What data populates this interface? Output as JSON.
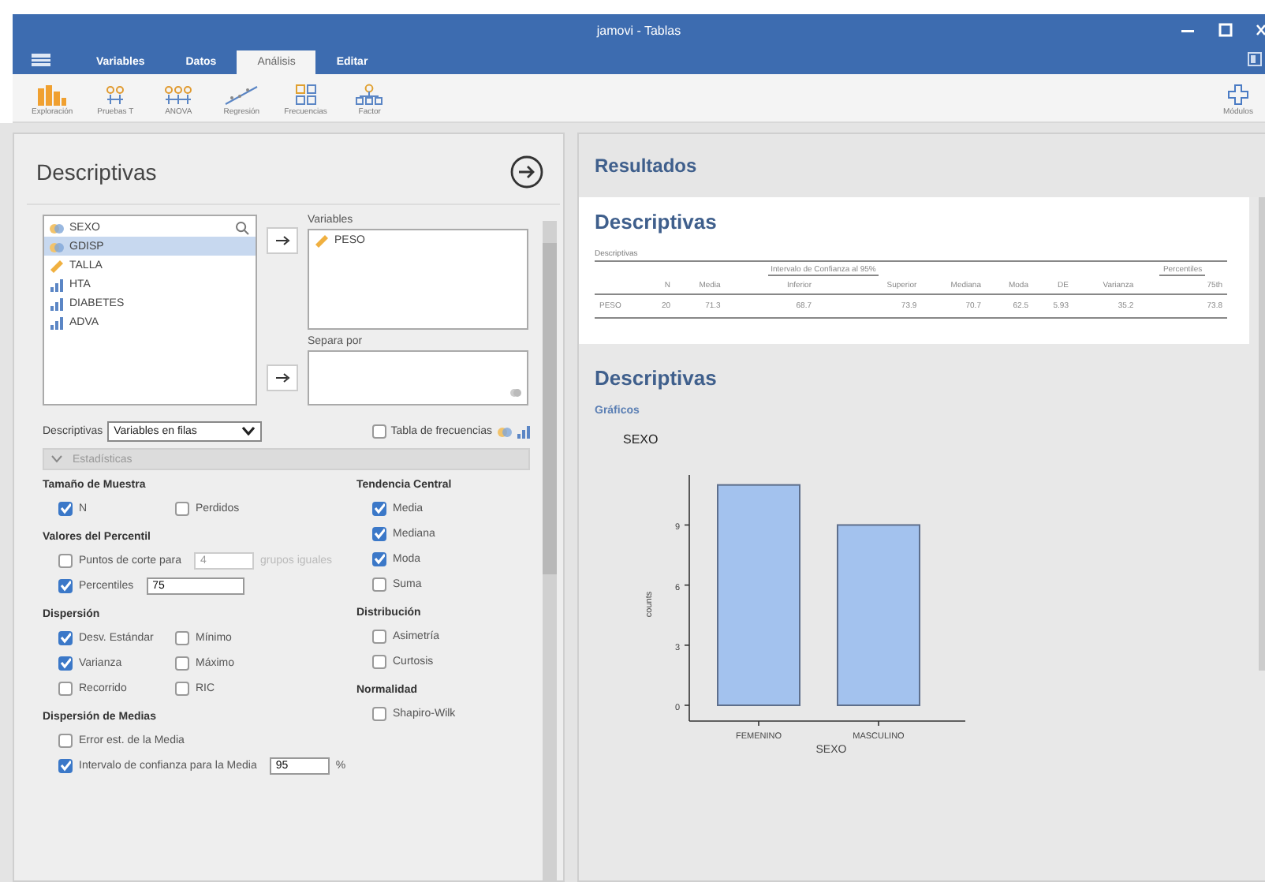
{
  "window": {
    "title": "jamovi - Tablas"
  },
  "menu_tabs": [
    {
      "label": "Variables",
      "selected": false
    },
    {
      "label": "Datos",
      "selected": false
    },
    {
      "label": "Análisis",
      "selected": true
    },
    {
      "label": "Editar",
      "selected": false
    }
  ],
  "ribbon": {
    "items": [
      {
        "label": "Exploración",
        "kind": "bars"
      },
      {
        "label": "Pruebas T",
        "kind": "ttest"
      },
      {
        "label": "ANOVA",
        "kind": "anova"
      },
      {
        "label": "Regresión",
        "kind": "regression"
      },
      {
        "label": "Frecuencias",
        "kind": "grid"
      },
      {
        "label": "Factor",
        "kind": "factor"
      }
    ],
    "modules": "Módulos"
  },
  "options": {
    "title": "Descriptivas",
    "variables": [
      {
        "name": "SEXO",
        "kind": "nominal",
        "selected": false
      },
      {
        "name": "GDISP",
        "kind": "nominal",
        "selected": true
      },
      {
        "name": "TALLA",
        "kind": "continuous",
        "selected": false
      },
      {
        "name": "HTA",
        "kind": "ordinal",
        "selected": false
      },
      {
        "name": "DIABETES",
        "kind": "ordinal",
        "selected": false
      },
      {
        "name": "ADVA",
        "kind": "ordinal",
        "selected": false
      }
    ],
    "target_variables": {
      "label": "Variables",
      "items": [
        {
          "name": "PESO",
          "kind": "continuous"
        }
      ]
    },
    "split_by": {
      "label": "Separa por"
    },
    "layout": {
      "label": "Descriptivas",
      "value": "Variables en filas"
    },
    "frequency_table": {
      "label": "Tabla de frecuencias",
      "checked": false
    },
    "section": {
      "label": "Estadísticas",
      "expanded": true
    },
    "option_columns": [
      {
        "groups": [
          {
            "title": "Tamaño de Muestra",
            "rows": [
              [
                {
                  "label": "N",
                  "checked": true
                },
                {
                  "label": "Perdidos",
                  "checked": false
                }
              ]
            ]
          },
          {
            "title": "Valores del Percentil",
            "rows": [
              [
                {
                  "label": "Puntos de corte para",
                  "checked": false,
                  "value": "4",
                  "suffix": "grupos iguales",
                  "disabled": true
                }
              ],
              [
                {
                  "label": "Percentiles",
                  "checked": true,
                  "value": "75"
                }
              ]
            ]
          },
          {
            "title": "Dispersión",
            "rows": [
              [
                {
                  "label": "Desv. Estándar",
                  "checked": true
                },
                {
                  "label": "Mínimo",
                  "checked": false
                }
              ],
              [
                {
                  "label": "Varianza",
                  "checked": true
                },
                {
                  "label": "Máximo",
                  "checked": false
                }
              ],
              [
                {
                  "label": "Recorrido",
                  "checked": false
                },
                {
                  "label": "RIC",
                  "checked": false
                }
              ]
            ]
          },
          {
            "title": "Dispersión de Medias",
            "rows": [
              [
                {
                  "label": "Error est. de la Media",
                  "checked": false
                }
              ],
              [
                {
                  "label": "Intervalo de confianza para la Media",
                  "checked": true,
                  "value": "95",
                  "suffix": "%",
                  "disabled": false
                }
              ]
            ]
          }
        ]
      },
      {
        "groups": [
          {
            "title": "Tendencia Central",
            "rows": [
              [
                {
                  "label": "Media",
                  "checked": true
                }
              ],
              [
                {
                  "label": "Mediana",
                  "checked": true
                }
              ],
              [
                {
                  "label": "Moda",
                  "checked": true
                }
              ],
              [
                {
                  "label": "Suma",
                  "checked": false
                }
              ]
            ]
          },
          {
            "title": "Distribución",
            "rows": [
              [
                {
                  "label": "Asimetría",
                  "checked": false
                }
              ],
              [
                {
                  "label": "Curtosis",
                  "checked": false
                }
              ]
            ]
          },
          {
            "title": "Normalidad",
            "rows": [
              [
                {
                  "label": "Shapiro-Wilk",
                  "checked": false
                }
              ]
            ]
          }
        ]
      }
    ]
  },
  "results": {
    "title": "Resultados",
    "analysis_title": "Descriptivas",
    "table": {
      "title": "Descriptivas",
      "column_groups": [
        {
          "columns": [
            "N",
            "Media"
          ]
        },
        {
          "label": "Intervalo de Confianza al 95%",
          "columns": [
            "Inferior",
            "Superior"
          ]
        },
        {
          "columns": [
            "Mediana",
            "Moda",
            "DE",
            "Varianza"
          ]
        },
        {
          "label": "Percentiles",
          "columns": [
            "75th"
          ]
        }
      ],
      "rows": [
        {
          "label": "PESO",
          "values": [
            "20",
            "71.3",
            "68.7",
            "73.9",
            "70.7",
            "62.5",
            "5.93",
            "35.2",
            "73.8"
          ]
        }
      ]
    },
    "plots": {
      "title": "Descriptivas",
      "subtitle": "Gráficos",
      "chart_data": {
        "type": "bar",
        "title": "SEXO",
        "xlabel": "SEXO",
        "ylabel": "counts",
        "categories": [
          "FEMENINO",
          "MASCULINO"
        ],
        "values": [
          11,
          9
        ],
        "ylim": [
          0,
          11.5
        ],
        "yticks": [
          0,
          3,
          6,
          9
        ]
      }
    }
  }
}
